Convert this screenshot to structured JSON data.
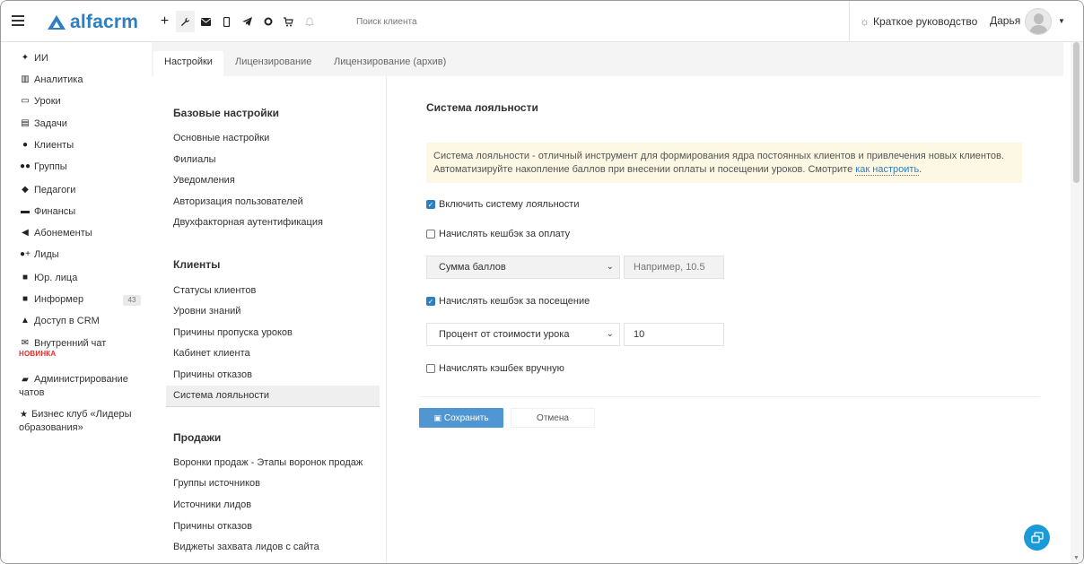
{
  "topbar": {
    "logo_text": "alfacrm",
    "search_placeholder": "Поиск клиента",
    "guide_label": "Краткое руководство",
    "user_name": "Дарья",
    "icons": [
      "plus-icon",
      "wrench-icon",
      "mail-icon",
      "phone-icon",
      "telegram-icon",
      "circle-icon",
      "cart-icon",
      "bell-icon"
    ]
  },
  "sidebar": {
    "items": [
      {
        "label": "ИИ",
        "icon": "sparkle-icon"
      },
      {
        "label": "Аналитика",
        "icon": "chart-icon"
      },
      {
        "label": "Уроки",
        "icon": "calendar-icon"
      },
      {
        "label": "Задачи",
        "icon": "clipboard-icon"
      },
      {
        "label": "Клиенты",
        "icon": "user-icon"
      },
      {
        "label": "Группы",
        "icon": "users-icon"
      },
      {
        "label": "Педагоги",
        "icon": "graduation-icon"
      },
      {
        "label": "Финансы",
        "icon": "money-icon"
      },
      {
        "label": "Абонементы",
        "icon": "tag-icon"
      },
      {
        "label": "Лиды",
        "icon": "user-plus-icon"
      },
      {
        "label": "Юр. лица",
        "icon": "briefcase-icon"
      },
      {
        "label": "Информер",
        "icon": "card-icon",
        "badge": "43"
      },
      {
        "label": "Доступ в CRM",
        "icon": "lock-icon"
      },
      {
        "label": "Внутренний чат",
        "icon": "envelope-icon",
        "note": "НОВИНКА"
      },
      {
        "label": "Администрирование чатов",
        "icon": "chat-icon"
      },
      {
        "label": "Бизнес клуб «Лидеры образования»",
        "icon": "star-icon"
      }
    ]
  },
  "tabs": [
    {
      "label": "Настройки"
    },
    {
      "label": "Лицензирование"
    },
    {
      "label": "Лицензирование (архив)"
    }
  ],
  "settings_nav": {
    "groups": [
      {
        "title": "Базовые настройки",
        "links": [
          "Основные настройки",
          "Филиалы",
          "Уведомления",
          "Авторизация пользователей",
          "Двухфакторная аутентификация"
        ]
      },
      {
        "title": "Клиенты",
        "links": [
          "Статусы клиентов",
          "Уровни знаний",
          "Причины пропуска уроков",
          "Кабинет клиента",
          "Причины отказов",
          "Система лояльности"
        ]
      },
      {
        "title": "Продажи",
        "links": [
          "Воронки продаж - Этапы воронок продаж",
          "Группы источников",
          "Источники лидов",
          "Причины отказов",
          "Виджеты захвата лидов с сайта"
        ]
      }
    ]
  },
  "form": {
    "title": "Система лояльности",
    "alert_line1": "Система лояльности - отличный инструмент для формирования ядра постоянных клиентов и привлечения новых клиентов.",
    "alert_line2": "Автоматизируйте накопление баллов при внесении оплаты и посещении уроков. Смотрите ",
    "alert_link": "как настроить",
    "alert_end": ".",
    "enable_label": "Включить систему лояльности",
    "enable_checked": true,
    "cashback_payment_label": "Начислять кешбэк за оплату",
    "cashback_payment_checked": false,
    "payment_select_value": "Сумма баллов",
    "payment_input_placeholder": "Например, 10.5",
    "cashback_visit_label": "Начислять кешбэк за посещение",
    "cashback_visit_checked": true,
    "visit_select_value": "Процент от стоимости урока",
    "visit_input_value": "10",
    "cashback_manual_label": "Начислять кэшбек вручную",
    "cashback_manual_checked": false,
    "save_label": "Сохранить",
    "cancel_label": "Отмена"
  }
}
